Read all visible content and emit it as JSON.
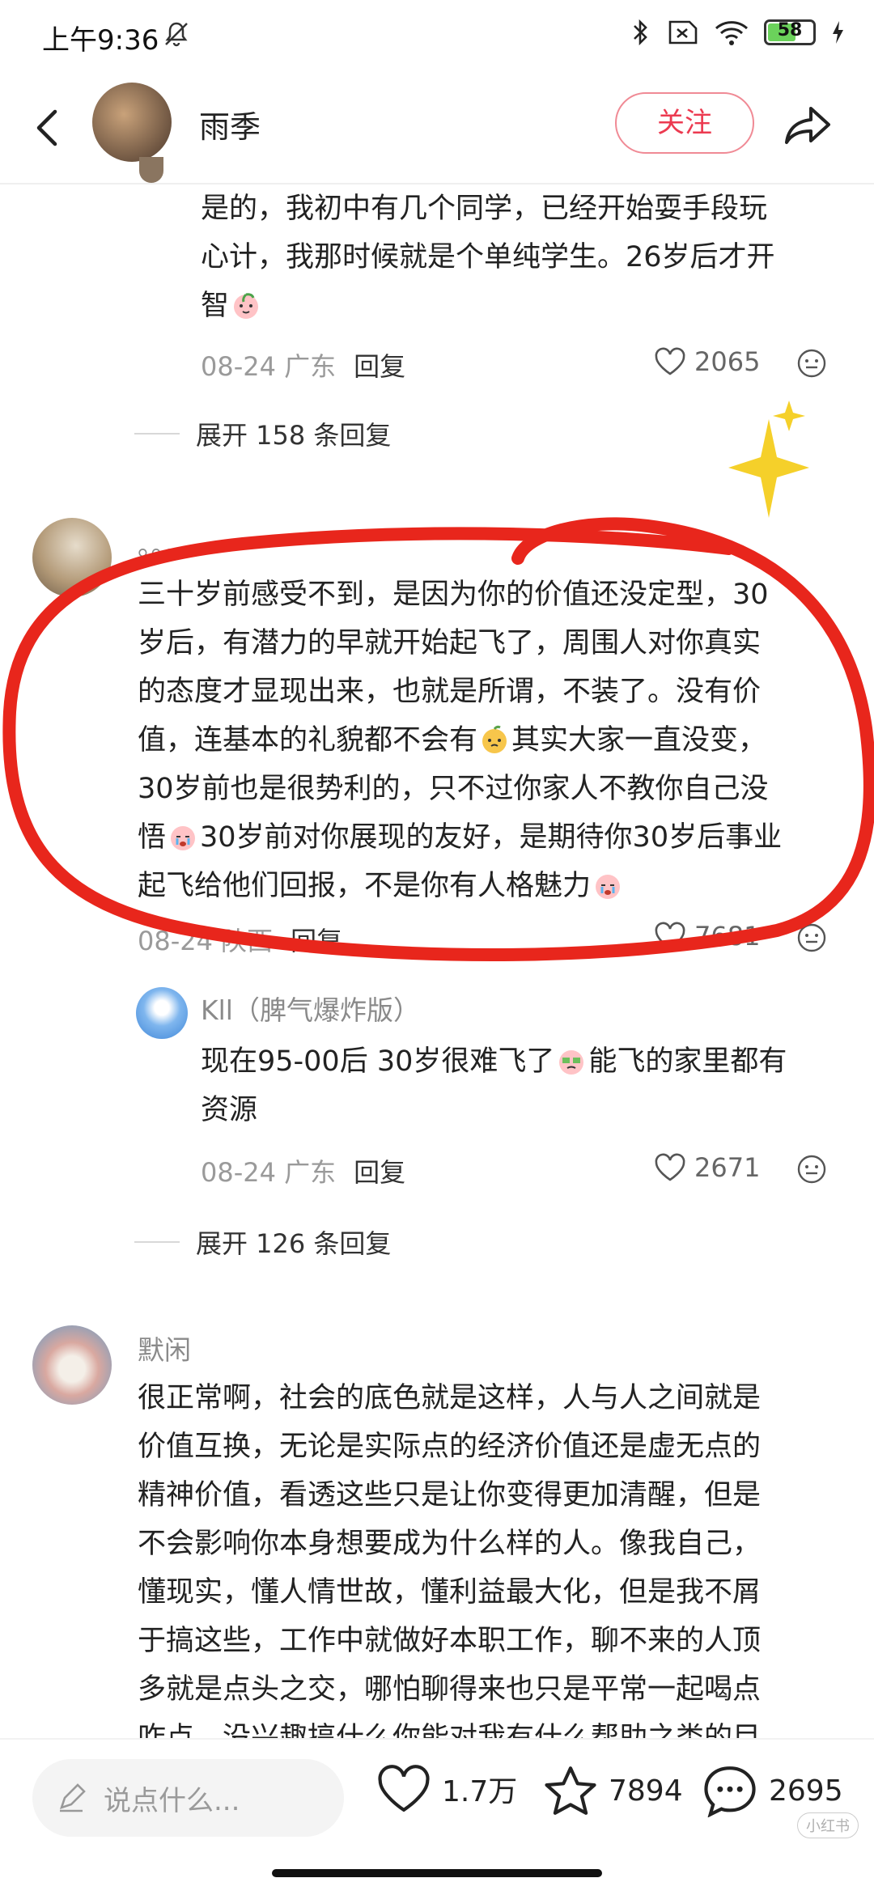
{
  "status_bar": {
    "time": "上午9:36",
    "battery": "58"
  },
  "header": {
    "username": "雨季",
    "follow_label": "关注"
  },
  "comments": [
    {
      "text": "是的，我初中有几个同学，已经开始耍手段玩心计，我那时候就是个单纯学生。26岁后才开智",
      "lines": [
        "是的，我初中有几个同学，已经开始耍手段玩",
        "心计，我那时候就是个单纯学生。26岁后才开",
        "智"
      ],
      "date": "08-24",
      "location": "广东",
      "reply_label": "回复",
      "likes": "2065",
      "expand_label": "展开 158 条回复"
    },
    {
      "username": "。。。",
      "lines": [
        "三十岁前感受不到，是因为你的价值还没定型，30",
        "岁后，有潜力的早就开始起飞了，周围人对你真实",
        "的态度才显现出来，也就是所谓，不装了。没有价",
        "值，连基本的礼貌都不会有",
        "其实大家一直没变，",
        "30岁前也是很势利的，只不过你家人不教你自己没",
        "悟",
        "30岁前对你展现的友好，是期待你30岁后事业",
        "起飞给他们回报，不是你有人格魅力"
      ],
      "date": "08-24",
      "location": "陕西",
      "reply_label": "回复",
      "likes": "7681",
      "sub_reply": {
        "username": "Kll（脾气爆炸版）",
        "line1": "现在95-00后 30岁很难飞了",
        "line1b": "能飞的家里都有",
        "line2": "资源",
        "date": "08-24",
        "location": "广东",
        "reply_label": "回复",
        "likes": "2671"
      },
      "expand_label": "展开 126 条回复"
    },
    {
      "username": "默闲",
      "lines": [
        "很正常啊，社会的底色就是这样，人与人之间就是",
        "价值互换，无论是实际点的经济价值还是虚无点的",
        "精神价值，看透这些只是让你变得更加清醒，但是",
        "不会影响你本身想要成为什么样的人。像我自己，",
        "懂现实，懂人情世故，懂利益最大化，但是我不屑",
        "于搞这些，工作中就做好本职工作，聊不来的人顶",
        "多就是点头之交，哪怕聊得来也只是平常一起喝点",
        "咋点，没兴趣搞什么你能对我有什么帮助之类的目"
      ]
    }
  ],
  "bottom_bar": {
    "input_placeholder": "说点什么...",
    "likes": "1.7万",
    "stars": "7894",
    "comments": "2695"
  },
  "watermark": "小红书",
  "colors": {
    "accent": "#ec3a50",
    "annotation": "#e8261c",
    "sparkle": "#f5d02a"
  }
}
